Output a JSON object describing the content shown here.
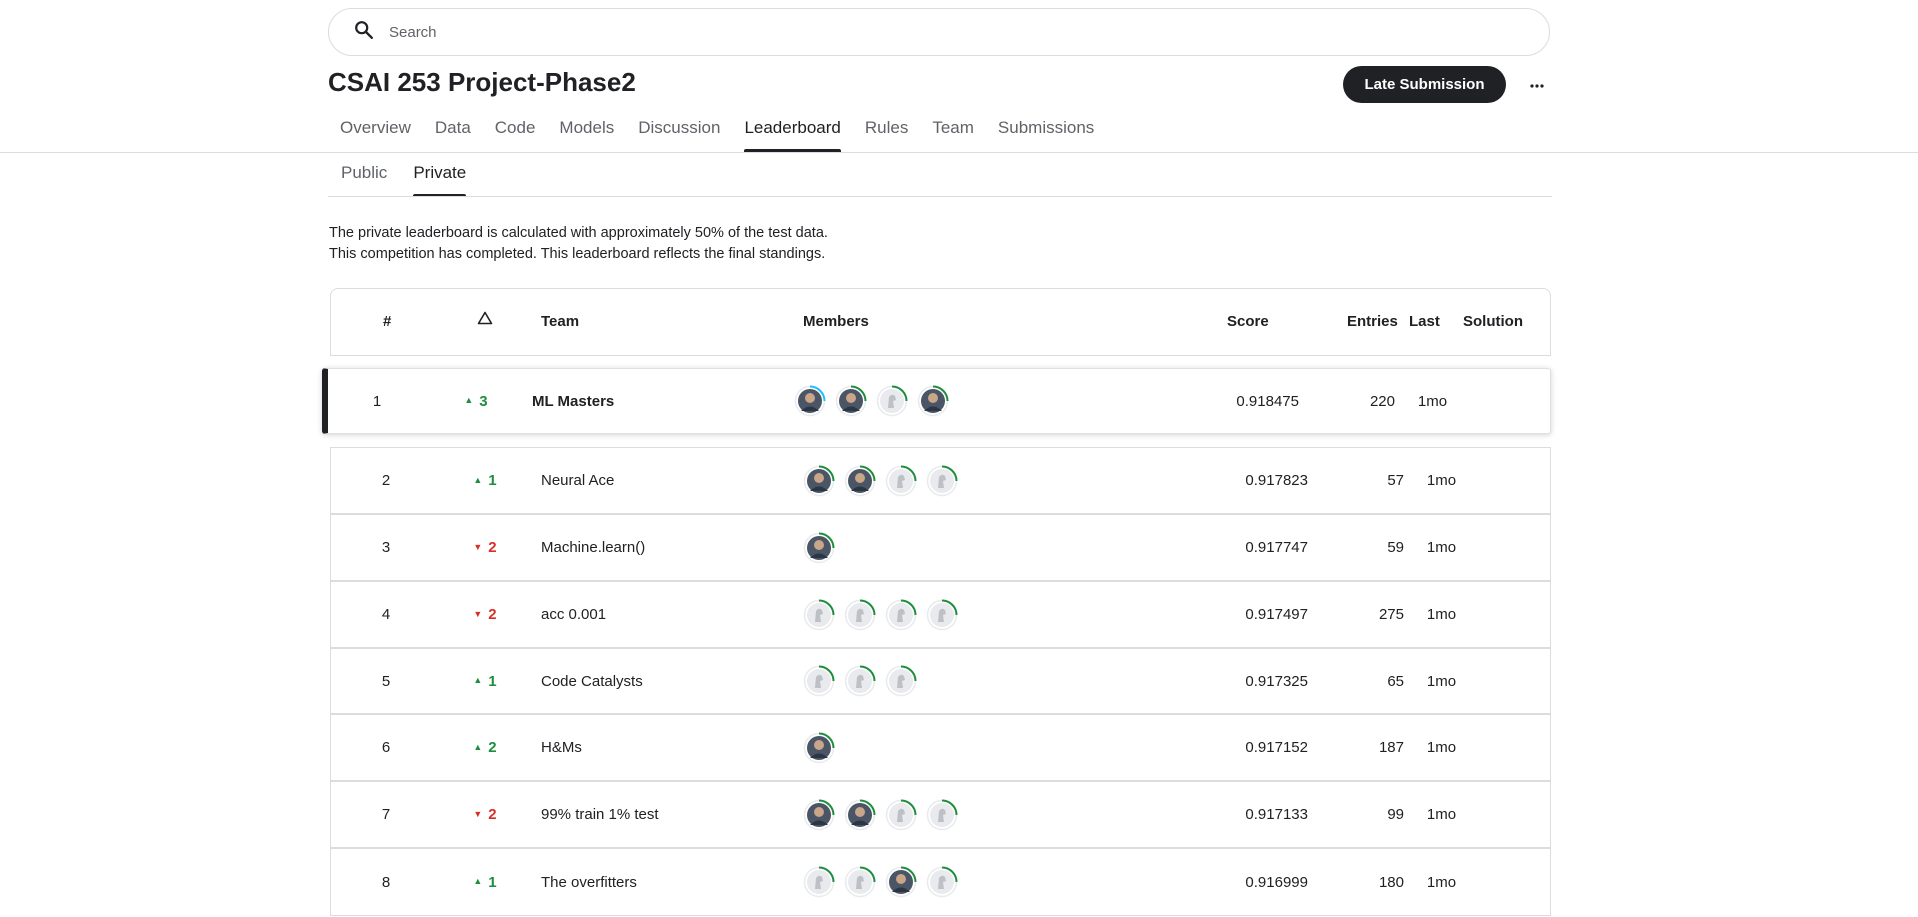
{
  "search": {
    "placeholder": "Search"
  },
  "page": {
    "title": "CSAI 253 Project-Phase2"
  },
  "actions": {
    "late_submission": "Late Submission",
    "more_icon": "more-horizontal-icon"
  },
  "tabs": [
    {
      "label": "Overview"
    },
    {
      "label": "Data"
    },
    {
      "label": "Code"
    },
    {
      "label": "Models"
    },
    {
      "label": "Discussion"
    },
    {
      "label": "Leaderboard",
      "active": true
    },
    {
      "label": "Rules"
    },
    {
      "label": "Team"
    },
    {
      "label": "Submissions"
    }
  ],
  "subtabs": [
    {
      "label": "Public"
    },
    {
      "label": "Private",
      "active": true
    }
  ],
  "description": {
    "line1": "The private leaderboard is calculated with approximately 50% of the test data.",
    "line2": "This competition has completed. This leaderboard reflects the final standings."
  },
  "table": {
    "columns": {
      "rank": "#",
      "delta_icon": "triangle-outline-icon",
      "team": "Team",
      "members": "Members",
      "score": "Score",
      "entries": "Entries",
      "last": "Last",
      "solution": "Solution"
    },
    "rows": [
      {
        "rank": "1",
        "delta": "3",
        "dir": "up",
        "team": "ML Masters",
        "members": [
          "photo",
          "photo",
          "default",
          "photo"
        ],
        "score": "0.918475",
        "entries": "220",
        "last": "1mo"
      },
      {
        "rank": "2",
        "delta": "1",
        "dir": "up",
        "team": "Neural Ace",
        "members": [
          "photo",
          "photo",
          "default",
          "default"
        ],
        "score": "0.917823",
        "entries": "57",
        "last": "1mo"
      },
      {
        "rank": "3",
        "delta": "2",
        "dir": "down",
        "team": "Machine.learn()",
        "members": [
          "photo"
        ],
        "score": "0.917747",
        "entries": "59",
        "last": "1mo"
      },
      {
        "rank": "4",
        "delta": "2",
        "dir": "down",
        "team": "acc 0.001",
        "members": [
          "default",
          "default",
          "default",
          "default"
        ],
        "score": "0.917497",
        "entries": "275",
        "last": "1mo"
      },
      {
        "rank": "5",
        "delta": "1",
        "dir": "up",
        "team": "Code Catalysts",
        "members": [
          "default",
          "default",
          "default"
        ],
        "score": "0.917325",
        "entries": "65",
        "last": "1mo"
      },
      {
        "rank": "6",
        "delta": "2",
        "dir": "up",
        "team": "H&Ms",
        "members": [
          "photo"
        ],
        "score": "0.917152",
        "entries": "187",
        "last": "1mo"
      },
      {
        "rank": "7",
        "delta": "2",
        "dir": "down",
        "team": "99% train 1% test",
        "members": [
          "photo",
          "photo",
          "default",
          "default"
        ],
        "score": "0.917133",
        "entries": "99",
        "last": "1mo"
      },
      {
        "rank": "8",
        "delta": "1",
        "dir": "up",
        "team": "The overfitters",
        "members": [
          "default",
          "default",
          "photo",
          "default"
        ],
        "score": "0.916999",
        "entries": "180",
        "last": "1mo"
      }
    ]
  },
  "colors": {
    "up": "#1e8e3e",
    "down": "#d93025",
    "accent": "#202124",
    "ring": "#20beff"
  }
}
